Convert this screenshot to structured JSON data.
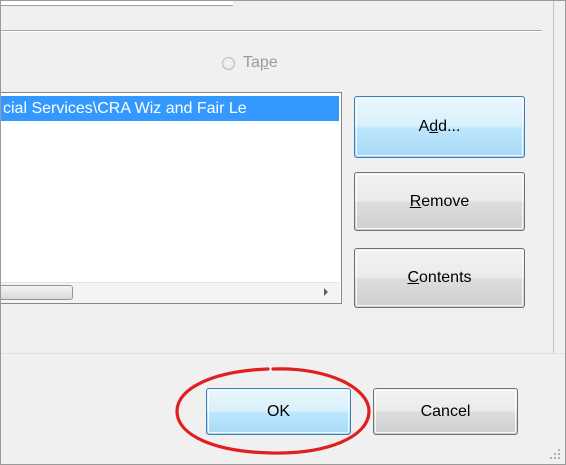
{
  "dialog": {
    "radio_tape_label_pre": "Ta",
    "radio_tape_label_u": "p",
    "radio_tape_label_post": "e",
    "list": {
      "items": [
        "cial Services\\CRA Wiz and Fair Le"
      ]
    },
    "buttons": {
      "add_pre": "A",
      "add_u": "d",
      "add_post": "d...",
      "remove_u": "R",
      "remove_post": "emove",
      "contents_u": "C",
      "contents_post": "ontents"
    }
  },
  "footer": {
    "ok_label": "OK",
    "cancel_label": "Cancel"
  },
  "colors": {
    "selection": "#3399ff",
    "highlight_ellipse": "#e02020",
    "disabled_text": "#9c9c9c"
  }
}
